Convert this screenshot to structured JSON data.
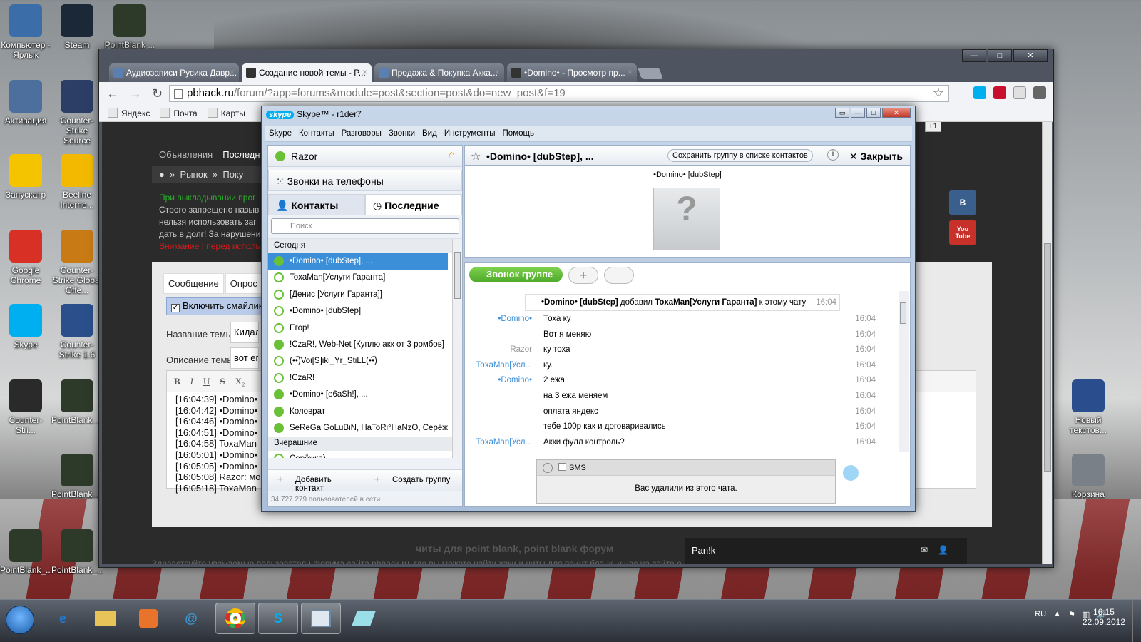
{
  "desktop": {
    "icons": [
      {
        "label": "Компьютер - Ярлык",
        "icon": "computer-icon",
        "color": "#3b6ea8"
      },
      {
        "label": "Steam",
        "icon": "steam-icon",
        "color": "#1b2838"
      },
      {
        "label": "PointBlank ...",
        "icon": "pointblank-icon",
        "color": "#2d3a2a"
      },
      {
        "label": "Активация",
        "icon": "activation-icon",
        "color": "#4d6f9e"
      },
      {
        "label": "Counter-Strike Source",
        "icon": "cs-source-icon",
        "color": "#2c3e66"
      },
      {
        "label": "Запускатр",
        "icon": "launcher-icon",
        "color": "#f5c400"
      },
      {
        "label": "Beeline Interne...",
        "icon": "beeline-icon",
        "color": "#f2b900"
      },
      {
        "label": "Google Chrome",
        "icon": "chrome-icon",
        "color": "#d93025"
      },
      {
        "label": "Counter-Strike Global Offe...",
        "icon": "csgo-icon",
        "color": "#c87b15"
      },
      {
        "label": "Skype",
        "icon": "skype-icon",
        "color": "#00aff0"
      },
      {
        "label": "Counter-Strike 1.6",
        "icon": "cs16-icon",
        "color": "#2a4f8a"
      },
      {
        "label": "Counter-Stri...",
        "icon": "halflife-icon",
        "color": "#2a2a2a"
      },
      {
        "label": "PointBlank_...",
        "icon": "pointblank-icon",
        "color": "#2d3a2a"
      },
      {
        "label": "PointBlank_...",
        "icon": "pointblank-icon",
        "color": "#2d3a2a"
      },
      {
        "label": "PointBlank_...",
        "icon": "pointblank-icon",
        "color": "#2d3a2a"
      },
      {
        "label": "PointBlank_...",
        "icon": "pointblank-icon",
        "color": "#2d3a2a"
      },
      {
        "label": "Новый текстов...",
        "icon": "text-file-icon",
        "color": "#2a4d8e"
      },
      {
        "label": "Корзина",
        "icon": "recycle-bin-icon",
        "color": "#7a8088"
      }
    ]
  },
  "chrome": {
    "tabs": [
      {
        "label": "Аудиозаписи Русика Давр..."
      },
      {
        "label": "Создание новой темы - P..."
      },
      {
        "label": "Продажа & Покупка Акка..."
      },
      {
        "label": "•Domino• - Просмотр пр..."
      }
    ],
    "url_host": "pbhack.ru",
    "url_path": "/forum/?app=forums&module=post&section=post&do=new_post&f=19",
    "bookmarks": [
      "Яндекс",
      "Почта",
      "Карты"
    ],
    "page": {
      "nav": [
        "Объявления",
        "Последн"
      ],
      "breadcrumb": [
        "Рынок",
        "Поку"
      ],
      "warn_green": "При выкладывании прог",
      "warn_lines": [
        "Строго запрещено назыв",
        "нельзя использовать заг",
        "дать в долг! За нарушени"
      ],
      "warn_red": "Внимание ! перед исполь",
      "form_tabs": [
        "Сообщение",
        "Опрос"
      ],
      "smiley_label": "Включить смайлик",
      "title_label": "Название темы",
      "title_value": "Кидал",
      "desc_label": "Описание темы",
      "desc_value": "вот ег",
      "editor_tools": [
        "B",
        "I",
        "U",
        "S",
        "X₂"
      ],
      "log_lines": [
        "[16:04:39] •Domino•",
        "[16:04:42] •Domino•",
        "[16:04:46] •Domino•",
        "[16:04:51] •Domino•",
        "[16:04:58] ToxaMan",
        "[16:05:01] •Domino•",
        "[16:05:05] •Domino•",
        "[16:05:08] Razor: мо",
        "[16:05:18] ToxaMan"
      ],
      "footer_title": "читы для point blank, point blank форум",
      "footer_text": "Здравствуйте уважаемые пользователи форума сайта pbhack.ru, где вы можете найти хаки и читы для поинт бланк, у нас на сайте е",
      "plus_one": "+1",
      "vk_label": "В",
      "youtube_label": "You Tube",
      "panik_label": "Pan!k"
    }
  },
  "skype": {
    "title": "Skype™ - r1der7",
    "logo": "skype",
    "menu": [
      "Skype",
      "Контакты",
      "Разговоры",
      "Звонки",
      "Вид",
      "Инструменты",
      "Помощь"
    ],
    "status_name": "Razor",
    "phone_calls": "Звонки на телефоны",
    "tab_contacts": "Контакты",
    "tab_recent": "Последние",
    "search_placeholder": "Поиск",
    "group_today": "Сегодня",
    "group_yesterday": "Вчерашние",
    "recent_today": [
      {
        "name": "•Domino• [dubStep], ...",
        "online": true,
        "selected": true
      },
      {
        "name": "ToxaMan[Услуги Гаранта]",
        "online": false
      },
      {
        "name": "[Денис [Услуги Гаранта]]",
        "online": false
      },
      {
        "name": "•Domino• [dubStep]",
        "online": false
      },
      {
        "name": "Егор!",
        "online": false
      },
      {
        "name": "!CzaR!, Web-Net [Куплю акк от 3 ромбов]",
        "online": true
      },
      {
        "name": "(•͡•)Voi[S]iki_Yr_StiLL(•͡•)",
        "online": false
      },
      {
        "name": "!CzaR!",
        "online": false
      },
      {
        "name": "•Domino• [e6aSh!], ...",
        "online": true
      },
      {
        "name": "Коловрат",
        "online": true
      },
      {
        "name": "SeReGa GoLuBiN, HaToRi°HaNzO, Серёжк...",
        "online": true
      }
    ],
    "recent_yesterday": [
      {
        "name": "Серёжка)",
        "online": false
      }
    ],
    "add_contact": "Добавить контакт",
    "create_group": "Создать группу",
    "online_count": "34 727 279 пользователей в сети",
    "chat_title": "•Domino• [dubStep], ...",
    "save_group": "Сохранить группу в списке контактов",
    "close": "Закрыть",
    "profile_name": "•Domino• [dubStep]",
    "group_call": "Звонок группе",
    "system_msg": {
      "actor": "•Domino• [dubStep]",
      "verb": "добавил",
      "target": "ToxaMan[Услуги Гаранта]",
      "suffix": "к этому чату",
      "time": "16:04"
    },
    "messages": [
      {
        "author": "•Domino•",
        "text": "Тоха ку",
        "time": "16:04",
        "self": false
      },
      {
        "author": "",
        "text": "Вот я меняю",
        "time": "16:04",
        "self": false
      },
      {
        "author": "Razor",
        "text": "ку тоха",
        "time": "16:04",
        "self": true
      },
      {
        "author": "ToxaMan[Усл...",
        "text": "ку.",
        "time": "16:04",
        "self": false
      },
      {
        "author": "•Domino•",
        "text": "2   ежа",
        "time": "16:04",
        "self": false
      },
      {
        "author": "",
        "text": "на 3 ежа меняем",
        "time": "16:04",
        "self": false
      },
      {
        "author": "",
        "text": "оплата яндекс",
        "time": "16:04",
        "self": false
      },
      {
        "author": "",
        "text": "тебе 100р как и договаривались",
        "time": "16:04",
        "self": false
      },
      {
        "author": "ToxaMan[Усл...",
        "text": "Акки фулл контроль?",
        "time": "16:04",
        "self": false
      }
    ],
    "sms_label": "SMS",
    "removed_notice": "Вас удалили из этого чата."
  },
  "taskbar": {
    "lang": "RU",
    "time": "16:15",
    "date": "22.09.2012"
  }
}
